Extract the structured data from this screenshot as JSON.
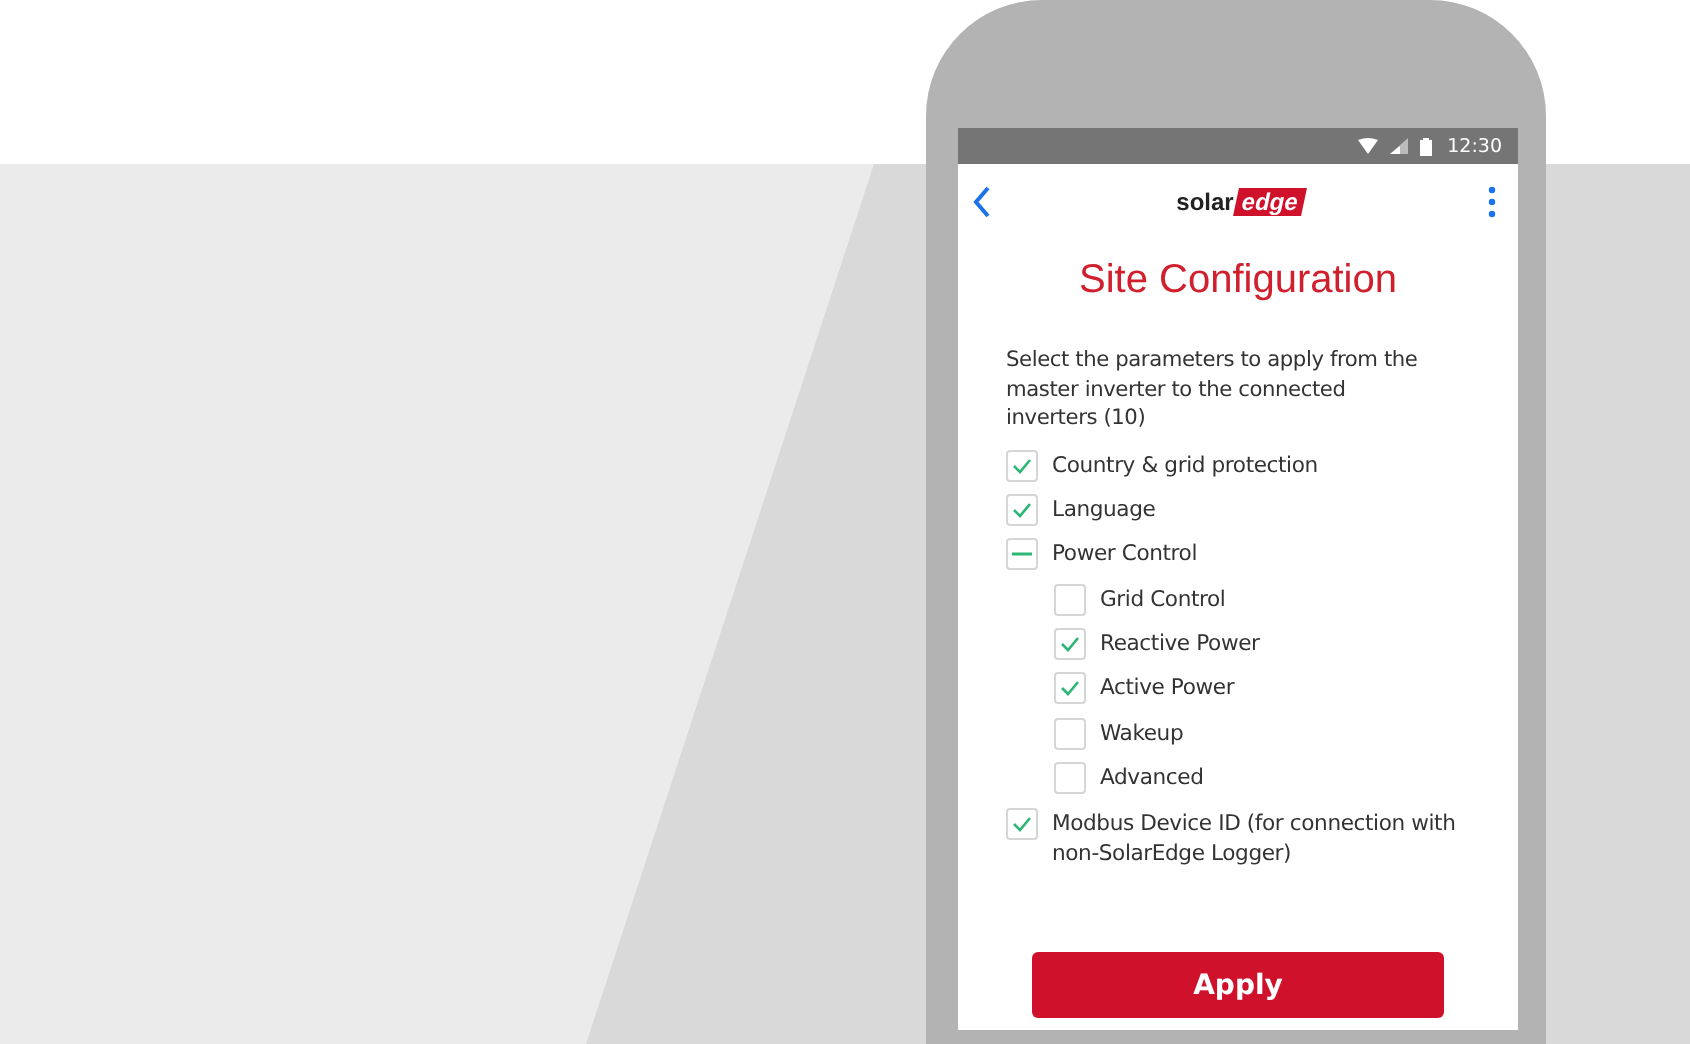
{
  "status_bar": {
    "time": "12:30"
  },
  "header": {
    "logo": [
      "solar",
      "edge"
    ]
  },
  "title": "Site Configuration",
  "description": "Select the parameters to apply from the master inverter to the connected inverters (10)",
  "options": [
    {
      "label": "Country & grid protection",
      "checked": true,
      "indeterminate": false
    },
    {
      "label": "Language",
      "checked": true,
      "indeterminate": false
    },
    {
      "label": "Power Control",
      "checked": false,
      "indeterminate": true,
      "children": [
        {
          "label": "Grid Control",
          "checked": false,
          "indeterminate": false
        },
        {
          "label": "Reactive Power",
          "checked": true,
          "indeterminate": false
        },
        {
          "label": "Active Power",
          "checked": true,
          "indeterminate": false
        },
        {
          "label": "Wakeup",
          "checked": false,
          "indeterminate": false
        },
        {
          "label": "Advanced",
          "checked": false,
          "indeterminate": false
        }
      ]
    },
    {
      "label": "Modbus Device ID (for connection with non-SolarEdge Logger)",
      "checked": true,
      "indeterminate": false
    }
  ],
  "apply_button": "Apply"
}
